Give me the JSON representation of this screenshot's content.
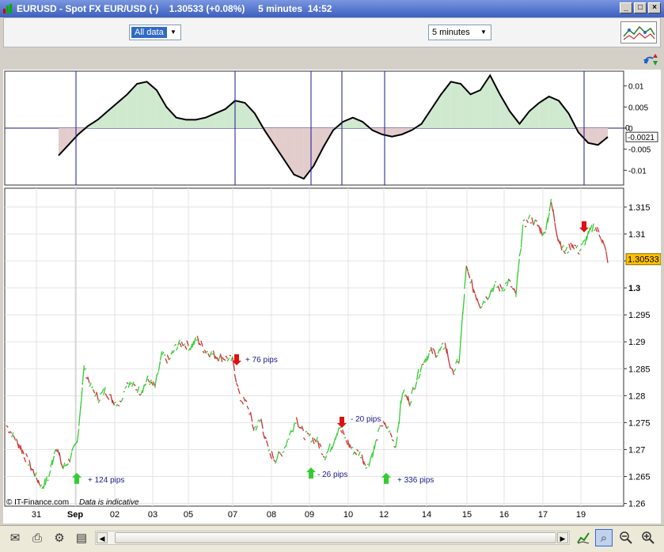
{
  "window": {
    "title": "EURUSD - Spot FX EUR/USD (-)    1.30533 (+0.08%)     5 minutes  14:52",
    "buttons": [
      "_",
      "□",
      "×"
    ]
  },
  "toolbar": {
    "range_select": "All data",
    "interval_select": "5 minutes",
    "indicator_icon": "indicator-settings-icon"
  },
  "chart_data": [
    {
      "type": "line",
      "title": "",
      "description_none": "",
      "x_labels": [
        "31",
        "Sep",
        "02",
        "03",
        "05",
        "07",
        "08",
        "09",
        "10",
        "12",
        "14",
        "15",
        "16",
        "17",
        "19"
      ],
      "y_ticks": [
        "0.01",
        "0.005",
        "0",
        "-0.005",
        "-0.01"
      ],
      "current_value_label": "-0.0021",
      "zero_label": "0",
      "series": [
        {
          "values": [
            -0.0065,
            -0.004,
            -0.0015,
            0.0005,
            0.002,
            0.004,
            0.006,
            0.008,
            0.0105,
            0.011,
            0.009,
            0.005,
            0.0025,
            0.002,
            0.002,
            0.0025,
            0.0035,
            0.0045,
            0.0065,
            0.006,
            0.0035,
            -0.0005,
            -0.004,
            -0.0075,
            -0.011,
            -0.012,
            -0.009,
            -0.0045,
            -0.0005,
            0.0015,
            0.0025,
            0.0015,
            -0.0005,
            -0.0015,
            -0.002,
            -0.0015,
            -0.0005,
            0.001,
            0.0045,
            0.008,
            0.011,
            0.0105,
            0.008,
            0.009,
            0.0125,
            0.008,
            0.004,
            0.001,
            0.004,
            0.006,
            0.0075,
            0.0065,
            0.0035,
            -0.001,
            -0.0035,
            -0.004,
            -0.0021
          ]
        }
      ]
    },
    {
      "type": "line",
      "title": "",
      "y_ticks": [
        "1.315",
        "1.31",
        "1.305",
        "1.3",
        "1.295",
        "1.29",
        "1.285",
        "1.28",
        "1.275",
        "1.27",
        "1.265",
        "1.26"
      ],
      "last_price_label": "1.30533",
      "ylim": [
        1.2595,
        1.3185
      ],
      "series": [
        {
          "values": [
            1.2745,
            1.2725,
            1.2705,
            1.2678,
            1.2655,
            1.263,
            1.2648,
            1.2708,
            1.2665,
            1.2683,
            1.2712,
            1.2852,
            1.2815,
            1.2795,
            1.281,
            1.2792,
            1.2785,
            1.2825,
            1.2818,
            1.2808,
            1.283,
            1.2815,
            1.2875,
            1.2865,
            1.2892,
            1.2898,
            1.289,
            1.2905,
            1.2885,
            1.2878,
            1.2872,
            1.287,
            1.2865,
            1.2795,
            1.2785,
            1.2738,
            1.2755,
            1.2698,
            1.2682,
            1.2695,
            1.2725,
            1.2758,
            1.2728,
            1.2722,
            1.2715,
            1.2688,
            1.2708,
            1.2742,
            1.2718,
            1.2698,
            1.2692,
            1.2668,
            1.2702,
            1.2748,
            1.2738,
            1.2705,
            1.2808,
            1.2788,
            1.2832,
            1.2865,
            1.2882,
            1.2878,
            1.2895,
            1.2842,
            1.2865,
            1.3035,
            1.2998,
            1.2968,
            1.2985,
            1.3005,
            1.2998,
            1.3012,
            1.2985,
            1.3115,
            1.3128,
            1.3118,
            1.3098,
            1.3158,
            1.3092,
            1.3065,
            1.3082,
            1.3068,
            1.3092,
            1.3115,
            1.3098,
            1.3053
          ]
        }
      ],
      "annotations": [
        {
          "label": "+ 124 pips",
          "direction": "up"
        },
        {
          "label": "+ 76 pips",
          "direction": "down"
        },
        {
          "label": "- 26 pips",
          "direction": "up"
        },
        {
          "label": "- 20 pips",
          "direction": "down"
        },
        {
          "label": "+ 336 pips",
          "direction": "up"
        },
        {
          "label": "",
          "direction": "down"
        }
      ],
      "signal_x_labels": [
        "Sep",
        "07",
        "09",
        "10",
        "12",
        "19"
      ]
    }
  ],
  "footer": {
    "copyright": "© IT-Finance.com",
    "note": "Data is indicative"
  },
  "bottom_toolbar": {
    "icons": [
      "mail-icon",
      "print-icon",
      "tools-icon",
      "notes-icon",
      "chart-type-icon",
      "zoom-fit-icon",
      "zoom-out-icon",
      "zoom-in-icon"
    ]
  },
  "colors": {
    "bull": "#33cc33",
    "bear": "#cc3333",
    "osc_pos_fill": "#cfe9cf",
    "osc_neg_fill": "#e3cccc",
    "signal_line": "#1a1a8c",
    "price_tag": "#ffc000"
  }
}
